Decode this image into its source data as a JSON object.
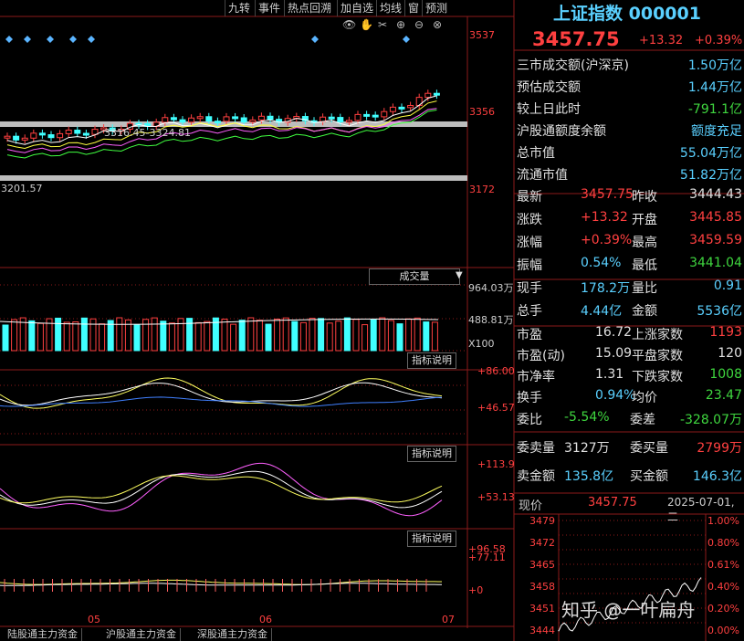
{
  "toolbar": [
    "九转",
    "事件",
    "热点回溯",
    "加自选",
    "均线",
    "窗",
    "预测"
  ],
  "toolbar_icons": [
    "eye-icon",
    "hand-icon",
    "scissors-icon",
    "zoom-in-icon",
    "zoom-out-icon",
    "close-icon"
  ],
  "index": {
    "name": "上证指数",
    "code": "000001",
    "price": "3457.75",
    "change": "+13.32",
    "pct": "+0.39%"
  },
  "summary": [
    {
      "label": "三市成交额(沪深京)",
      "value": "1.50万亿",
      "color": "#5ad0ff"
    },
    {
      "label": "预估成交额",
      "value": "1.44万亿",
      "color": "#5ad0ff"
    },
    {
      "label": "较上日此时",
      "value": "-791.1亿",
      "color": "#3fd63f"
    },
    {
      "label": "沪股通额度余额",
      "value": "额度充足",
      "color": "#5ad0ff"
    },
    {
      "label": "总市值",
      "value": "55.04万亿",
      "color": "#5ad0ff"
    },
    {
      "label": "流通市值",
      "value": "51.82万亿",
      "color": "#5ad0ff"
    }
  ],
  "quote": [
    {
      "l1": "最新",
      "v1": "3457.75",
      "c1": "#ff4040",
      "l2": "昨收",
      "v2": "3444.43",
      "c2": "#e0e0e0"
    },
    {
      "l1": "涨跌",
      "v1": "+13.32",
      "c1": "#ff4040",
      "l2": "开盘",
      "v2": "3445.85",
      "c2": "#ff4040"
    },
    {
      "l1": "涨幅",
      "v1": "+0.39%",
      "c1": "#ff4040",
      "l2": "最高",
      "v2": "3459.59",
      "c2": "#ff4040"
    },
    {
      "l1": "振幅",
      "v1": "0.54%",
      "c1": "#5ad0ff",
      "l2": "最低",
      "v2": "3441.04",
      "c2": "#3fd63f"
    },
    {
      "l1": "现手",
      "v1": "178.2万",
      "c1": "#5ad0ff",
      "l2": "量比",
      "v2": "0.91",
      "c2": "#5ad0ff"
    },
    {
      "l1": "总手",
      "v1": "4.44亿",
      "c1": "#5ad0ff",
      "l2": "金额",
      "v2": "5536亿",
      "c2": "#5ad0ff"
    }
  ],
  "stats": [
    {
      "l1": "市盈",
      "v1": "16.72",
      "c1": "#e0e0e0",
      "l2": "上涨家数",
      "v2": "1193",
      "c2": "#ff4040"
    },
    {
      "l1": "市盈(动)",
      "v1": "15.09",
      "c1": "#e0e0e0",
      "l2": "平盘家数",
      "v2": "120",
      "c2": "#e0e0e0"
    },
    {
      "l1": "市净率",
      "v1": "1.31",
      "c1": "#e0e0e0",
      "l2": "下跌家数",
      "v2": "1008",
      "c2": "#3fd63f"
    },
    {
      "l1": "换手",
      "v1": "0.94%",
      "c1": "#5ad0ff",
      "l2": "均价",
      "v2": "23.47",
      "c2": "#3fd63f"
    }
  ],
  "orders": [
    {
      "l1": "委比",
      "v1": "-5.54%",
      "c1": "#3fd63f",
      "l2": "委差",
      "v2": "-328.07万",
      "c2": "#3fd63f"
    },
    {
      "l1": "委卖量",
      "v1": "3127万",
      "c1": "#e0e0e0",
      "l2": "委买量",
      "v2": "2799万",
      "c2": "#ff4040"
    },
    {
      "l1": "卖金额",
      "v1": "135.8亿",
      "c1": "#5ad0ff",
      "l2": "买金额",
      "v2": "146.3亿",
      "c2": "#5ad0ff"
    }
  ],
  "intraday": {
    "label": "现价",
    "price": "3457.75",
    "date": "2025-07-01,二"
  },
  "intraday_y": [
    "3479",
    "3472",
    "3465",
    "3458",
    "3451",
    "3444"
  ],
  "intraday_pct": [
    "1.00%",
    "0.80%",
    "0.61%",
    "0.40%",
    "0.20%",
    "0.00%"
  ],
  "main_y": [
    "3537",
    "3356",
    "3172"
  ],
  "annotations": [
    "3316.45-3324.81",
    "3201.57"
  ],
  "volume": {
    "button": "成交量",
    "top": "964.03万",
    "mid": "488.81万",
    "mult": "X100"
  },
  "ind1": {
    "button": "指标说明",
    "top": "+86.00",
    "bottom": "+46.57"
  },
  "ind2": {
    "button": "指标说明",
    "top": "+113.9",
    "bottom": "+53.13"
  },
  "ind3": {
    "button": "指标说明",
    "top": "+96.58",
    "mid": "+77.11",
    "bottom": "+0"
  },
  "x_axis": [
    "05",
    "06",
    "07"
  ],
  "bottom_tabs": [
    "陆股通主力资金",
    "沪股通主力资金",
    "深股通主力资金"
  ],
  "watermark": "知乎 @一叶扁舟",
  "colors": {
    "up": "#ff4040",
    "down": "#40ffff",
    "grid": "#8b1a1a"
  }
}
